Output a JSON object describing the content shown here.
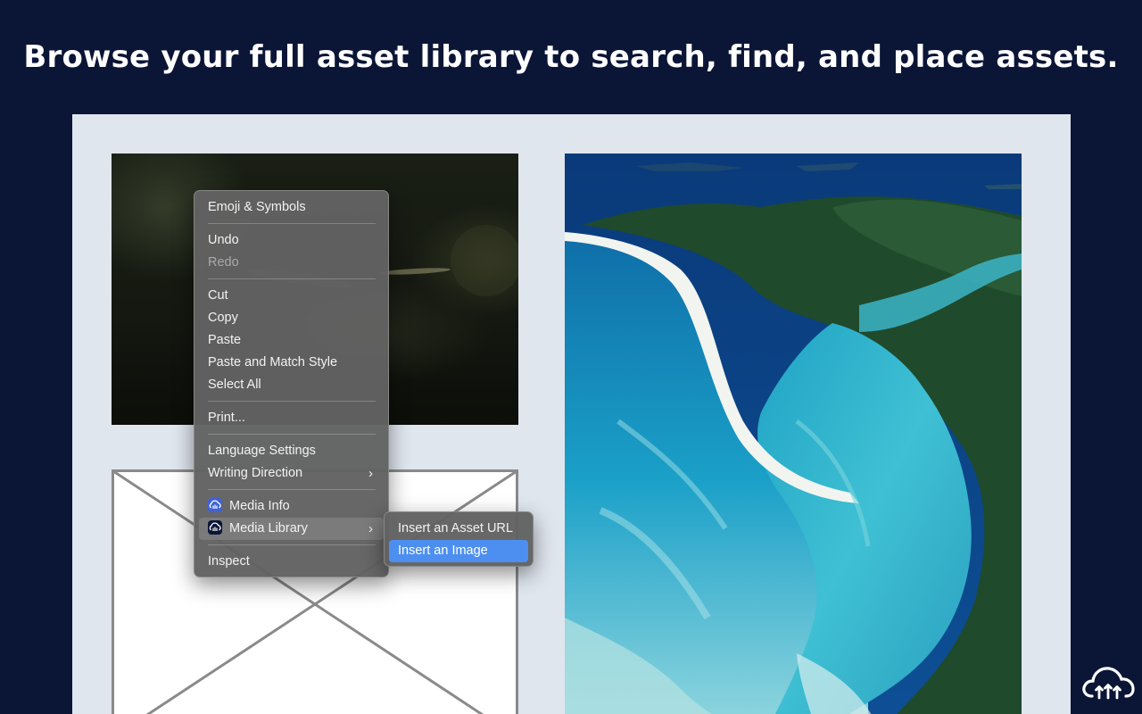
{
  "headline": "Browse your full asset library to search, find, and place assets.",
  "context_menu": {
    "emoji": "Emoji & Symbols",
    "undo": "Undo",
    "redo": "Redo",
    "cut": "Cut",
    "copy": "Copy",
    "paste": "Paste",
    "paste_match": "Paste and Match Style",
    "select_all": "Select All",
    "print": "Print...",
    "language_settings": "Language Settings",
    "writing_direction": "Writing Direction",
    "media_info": "Media Info",
    "media_library": "Media Library",
    "inspect": "Inspect",
    "chevron": "›"
  },
  "submenu": {
    "insert_url": "Insert an Asset URL",
    "insert_image": "Insert an Image"
  },
  "colors": {
    "background": "#0b1536",
    "canvas": "#dfe6ee",
    "selection": "#4d8ff0"
  },
  "icons": {
    "media_info": "cloudinary-icon",
    "media_library": "cloudinary-icon",
    "brand": "cloudinary-cloud-logo"
  }
}
